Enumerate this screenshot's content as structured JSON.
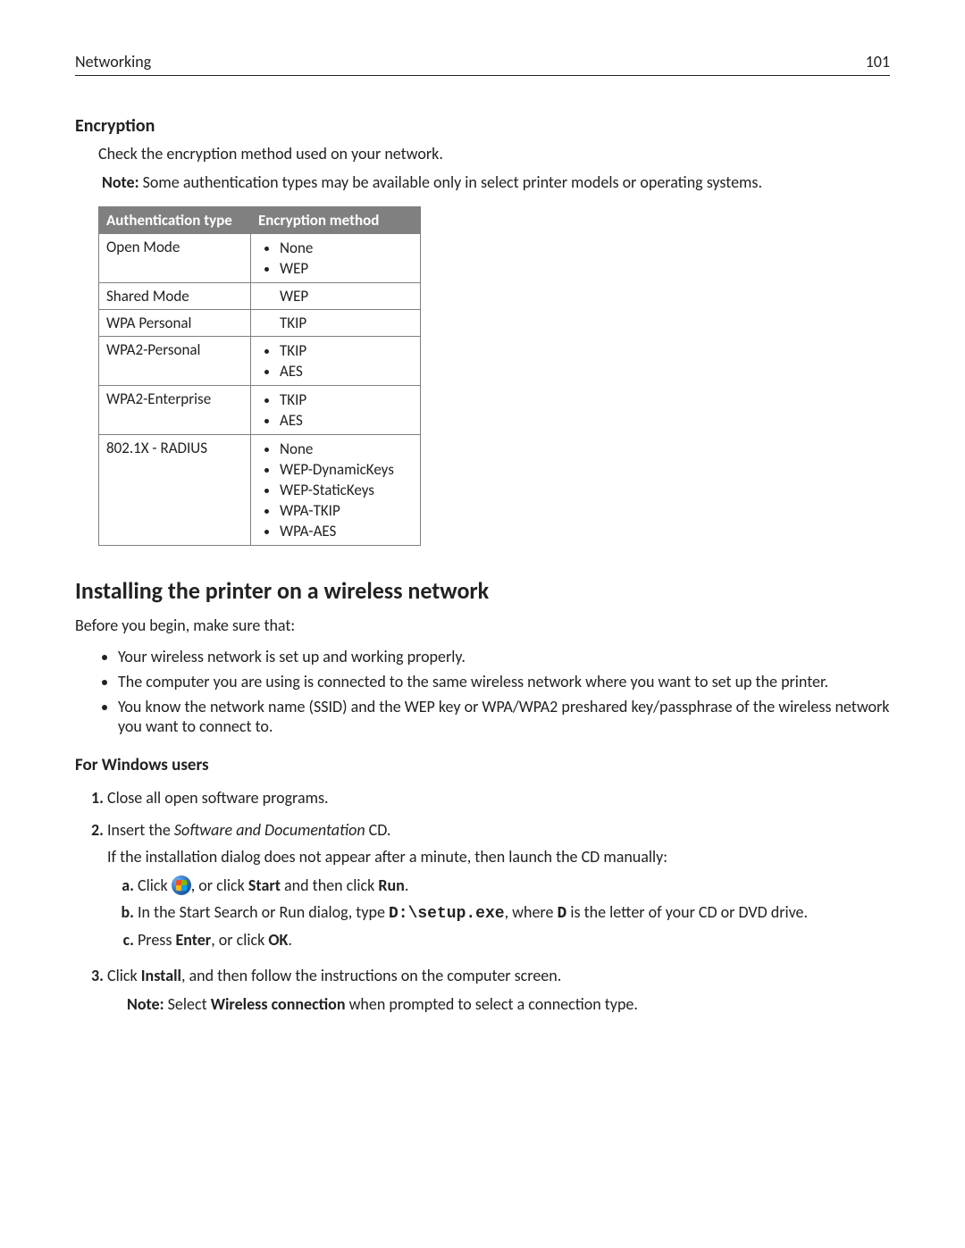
{
  "header": {
    "section": "Networking",
    "page": "101"
  },
  "encryption": {
    "heading": "Encryption",
    "intro": "Check the encryption method used on your network.",
    "note_prefix": "Note:",
    "note_body": " Some authentication types may be available only in select printer models or operating systems.",
    "table": {
      "col1": "Authentication type",
      "col2": "Encryption method",
      "rows": [
        {
          "auth": "Open Mode",
          "methods": [
            "None",
            "WEP"
          ],
          "bulleted": true
        },
        {
          "auth": "Shared Mode",
          "methods": [
            "WEP"
          ],
          "bulleted": false
        },
        {
          "auth": "WPA Personal",
          "methods": [
            "TKIP"
          ],
          "bulleted": false
        },
        {
          "auth": "WPA2-Personal",
          "methods": [
            "TKIP",
            "AES"
          ],
          "bulleted": true
        },
        {
          "auth": "WPA2-Enterprise",
          "methods": [
            "TKIP",
            "AES"
          ],
          "bulleted": true
        },
        {
          "auth": "802.1X - RADIUS",
          "methods": [
            "None",
            "WEP-DynamicKeys",
            "WEP-StaticKeys",
            "WPA-TKIP",
            "WPA-AES"
          ],
          "bulleted": true
        }
      ]
    }
  },
  "install": {
    "heading": "Installing the printer on a wireless network",
    "intro": "Before you begin, make sure that:",
    "bullets": [
      "Your wireless network is set up and working properly.",
      "The computer you are using is connected to the same wireless network where you want to set up the printer.",
      "You know the network name (SSID) and the WEP key or WPA/WPA2 preshared key/passphrase of the wireless network you want to connect to."
    ],
    "windows": {
      "heading": "For Windows users",
      "step1": "Close all open software programs.",
      "step2_prefix": "Insert the ",
      "step2_italic": "Software and Documentation",
      "step2_suffix": " CD.",
      "step2_sub": "If the installation dialog does not appear after a minute, then launch the CD manually:",
      "step2a_prefix": "Click ",
      "step2a_mid1": ", or click ",
      "step2a_bold1": "Start",
      "step2a_mid2": " and then click ",
      "step2a_bold2": "Run",
      "step2a_suffix": ".",
      "step2b_prefix": "In the Start Search or Run dialog, type ",
      "step2b_code": "D:\\setup.exe",
      "step2b_mid": ", where ",
      "step2b_code2": "D",
      "step2b_suffix": " is the letter of your CD or DVD drive.",
      "step2c_prefix": "Press ",
      "step2c_bold1": "Enter",
      "step2c_mid": ", or click ",
      "step2c_bold2": "OK",
      "step2c_suffix": ".",
      "step3_prefix": "Click ",
      "step3_bold": "Install",
      "step3_suffix": ", and then follow the instructions on the computer screen.",
      "step3_note_prefix": "Note:",
      "step3_note_mid1": " Select ",
      "step3_note_bold": "Wireless connection",
      "step3_note_suffix": " when prompted to select a connection type."
    }
  }
}
